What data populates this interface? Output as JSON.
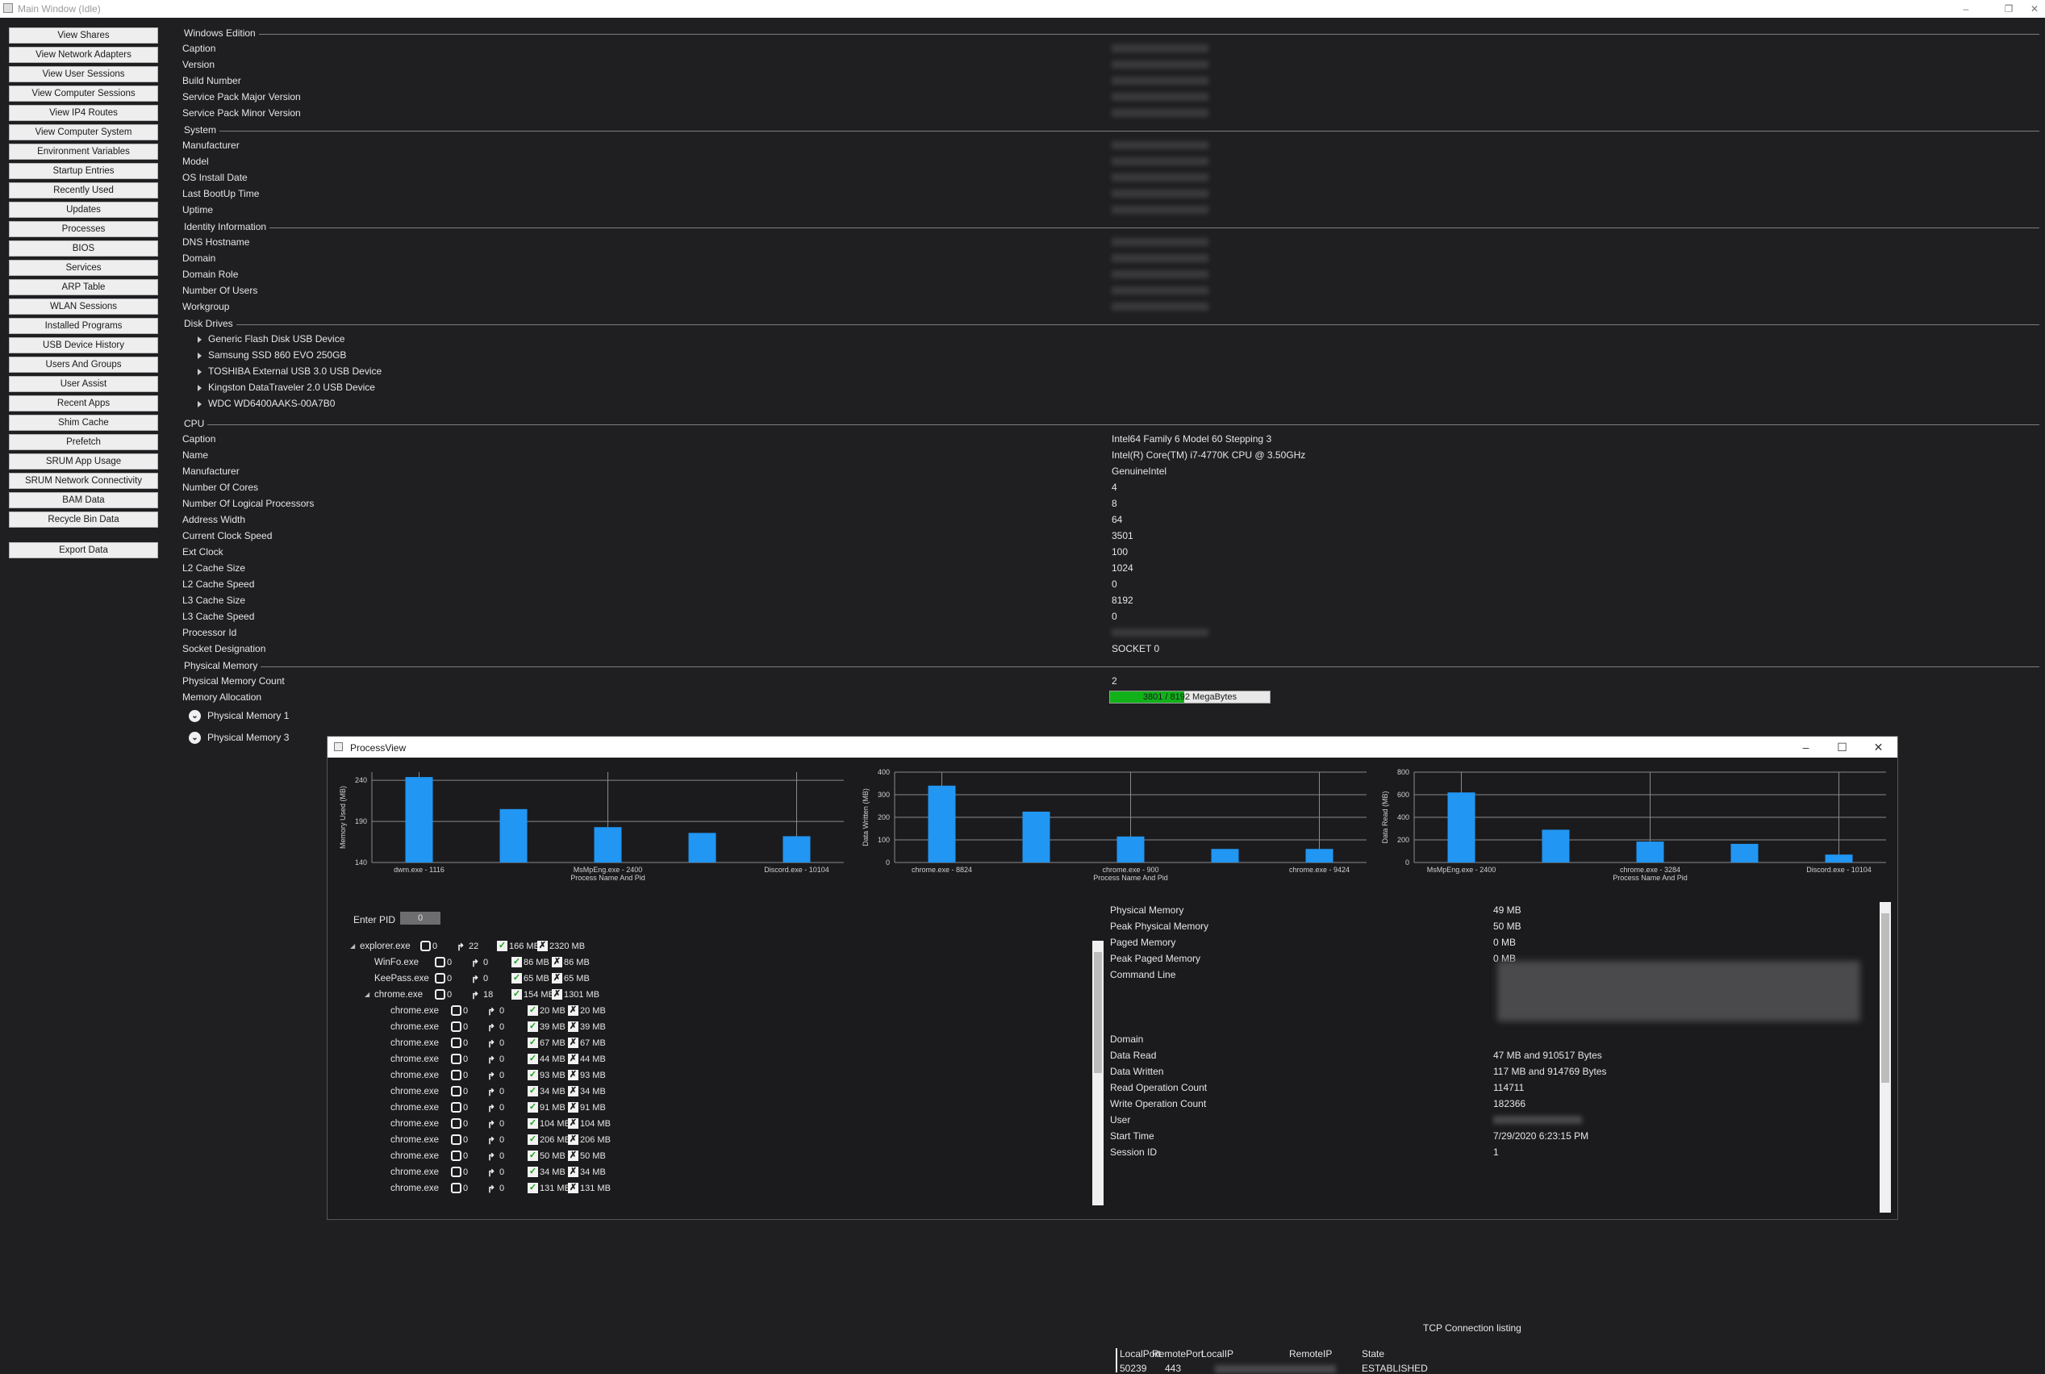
{
  "window": {
    "title": "Main Window (Idle)",
    "minimize": "–",
    "restore": "❐",
    "close": "✕"
  },
  "sidebar": {
    "buttons": [
      "View Shares",
      "View Network Adapters",
      "View User Sessions",
      "View Computer Sessions",
      "View IP4 Routes",
      "View Computer System",
      "Environment Variables",
      "Startup Entries",
      "Recently Used",
      "Updates",
      "Processes",
      "BIOS",
      "Services",
      "ARP Table",
      "WLAN Sessions",
      "Installed Programs",
      "USB Device History",
      "Users And Groups",
      "User Assist",
      "Recent Apps",
      "Shim Cache",
      "Prefetch",
      "SRUM App Usage",
      "SRUM Network Connectivity",
      "BAM Data",
      "Recycle Bin Data"
    ],
    "export": "Export Data"
  },
  "sections": {
    "windows_edition": {
      "title": "Windows Edition",
      "rows": [
        "Caption",
        "Version",
        "Build Number",
        "Service Pack Major Version",
        "Service Pack Minor Version"
      ]
    },
    "system": {
      "title": "System",
      "rows": [
        "Manufacturer",
        "Model",
        "OS Install Date",
        "Last BootUp Time",
        "Uptime"
      ]
    },
    "identity": {
      "title": "Identity Information",
      "rows": [
        "DNS Hostname",
        "Domain",
        "Domain Role",
        "Number Of Users",
        "Workgroup"
      ]
    },
    "disks": {
      "title": "Disk Drives",
      "items": [
        "Generic Flash Disk USB Device",
        "Samsung SSD 860 EVO 250GB",
        "TOSHIBA External USB 3.0 USB Device",
        "Kingston DataTraveler 2.0 USB Device",
        "WDC WD6400AAKS-00A7B0"
      ]
    },
    "cpu": {
      "title": "CPU",
      "rows": [
        {
          "k": "Caption",
          "v": "Intel64 Family 6 Model 60 Stepping 3"
        },
        {
          "k": "Name",
          "v": "Intel(R) Core(TM) i7-4770K CPU @ 3.50GHz"
        },
        {
          "k": "Manufacturer",
          "v": "GenuineIntel"
        },
        {
          "k": "Number Of Cores",
          "v": "4"
        },
        {
          "k": "Number Of Logical Processors",
          "v": "8"
        },
        {
          "k": "Address Width",
          "v": "64"
        },
        {
          "k": "Current Clock Speed",
          "v": "3501"
        },
        {
          "k": "Ext Clock",
          "v": "100"
        },
        {
          "k": "L2 Cache Size",
          "v": "1024"
        },
        {
          "k": "L2 Cache Speed",
          "v": "0"
        },
        {
          "k": "L3 Cache Size",
          "v": "8192"
        },
        {
          "k": "L3 Cache Speed",
          "v": "0"
        },
        {
          "k": "Processor Id",
          "v": ""
        },
        {
          "k": "Socket Designation",
          "v": "SOCKET 0"
        }
      ]
    },
    "physical_memory": {
      "title": "Physical Memory",
      "count_label": "Physical Memory Count",
      "count": "2",
      "alloc_label": "Memory Allocation",
      "alloc_text": "3801 / 8192 MegaBytes",
      "alloc_fraction": 0.464,
      "items": [
        "Physical Memory 1",
        "Physical Memory 3"
      ]
    }
  },
  "process_view": {
    "title": "ProcessView",
    "enter_pid_label": "Enter PID",
    "pid_value": "0",
    "tree": [
      {
        "name": "explorer.exe",
        "level": 0,
        "expanded": true,
        "handles": "0",
        "threads": "22",
        "mem": "166 MB",
        "peak": "2320 MB"
      },
      {
        "name": "WinFo.exe",
        "level": 1,
        "handles": "0",
        "threads": "0",
        "mem": "86 MB",
        "peak": "86 MB"
      },
      {
        "name": "KeePass.exe",
        "level": 1,
        "handles": "0",
        "threads": "0",
        "mem": "65 MB",
        "peak": "65 MB"
      },
      {
        "name": "chrome.exe",
        "level": 1,
        "expanded": true,
        "handles": "0",
        "threads": "18",
        "mem": "154 MB",
        "peak": "1301 MB"
      },
      {
        "name": "chrome.exe",
        "level": 2,
        "handles": "0",
        "threads": "0",
        "mem": "20 MB",
        "peak": "20 MB"
      },
      {
        "name": "chrome.exe",
        "level": 2,
        "handles": "0",
        "threads": "0",
        "mem": "39 MB",
        "peak": "39 MB"
      },
      {
        "name": "chrome.exe",
        "level": 2,
        "handles": "0",
        "threads": "0",
        "mem": "67 MB",
        "peak": "67 MB"
      },
      {
        "name": "chrome.exe",
        "level": 2,
        "handles": "0",
        "threads": "0",
        "mem": "44 MB",
        "peak": "44 MB"
      },
      {
        "name": "chrome.exe",
        "level": 2,
        "handles": "0",
        "threads": "0",
        "mem": "93 MB",
        "peak": "93 MB"
      },
      {
        "name": "chrome.exe",
        "level": 2,
        "handles": "0",
        "threads": "0",
        "mem": "34 MB",
        "peak": "34 MB"
      },
      {
        "name": "chrome.exe",
        "level": 2,
        "handles": "0",
        "threads": "0",
        "mem": "91 MB",
        "peak": "91 MB"
      },
      {
        "name": "chrome.exe",
        "level": 2,
        "handles": "0",
        "threads": "0",
        "mem": "104 MB",
        "peak": "104 MB"
      },
      {
        "name": "chrome.exe",
        "level": 2,
        "handles": "0",
        "threads": "0",
        "mem": "206 MB",
        "peak": "206 MB"
      },
      {
        "name": "chrome.exe",
        "level": 2,
        "handles": "0",
        "threads": "0",
        "mem": "50 MB",
        "peak": "50 MB"
      },
      {
        "name": "chrome.exe",
        "level": 2,
        "handles": "0",
        "threads": "0",
        "mem": "34 MB",
        "peak": "34 MB"
      },
      {
        "name": "chrome.exe",
        "level": 2,
        "handles": "0",
        "threads": "0",
        "mem": "131 MB",
        "peak": "131 MB"
      }
    ],
    "info": [
      {
        "k": "Physical Memory",
        "v": "49 MB"
      },
      {
        "k": "Peak Physical Memory",
        "v": "50 MB"
      },
      {
        "k": "Paged Memory",
        "v": "0 MB"
      },
      {
        "k": "Peak Paged Memory",
        "v": "0 MB"
      },
      {
        "k": "Command Line",
        "v": ""
      }
    ],
    "info2": [
      {
        "k": "Domain",
        "v": ""
      },
      {
        "k": "Data Read",
        "v": "47 MB and 910517 Bytes"
      },
      {
        "k": "Data Written",
        "v": "117 MB and 914769 Bytes"
      },
      {
        "k": "Read Operation Count",
        "v": "114711"
      },
      {
        "k": "Write Operation Count",
        "v": "182366"
      },
      {
        "k": "User",
        "v": ""
      },
      {
        "k": "Start Time",
        "v": "7/29/2020 6:23:15 PM"
      },
      {
        "k": "Session ID",
        "v": "1"
      }
    ],
    "tcp": {
      "title": "TCP Connection listing",
      "headers": [
        "LocalPort",
        "RemotePort",
        "LocalIP",
        "RemoteIP",
        "State"
      ],
      "row": {
        "local_port": "50239",
        "remote_port": "443",
        "state": "ESTABLISHED"
      }
    }
  },
  "chart_data": [
    {
      "type": "bar",
      "ylabel": "Memory Used (MB)",
      "xlabel": "Process Name And Pid",
      "ylim": [
        140,
        250
      ],
      "yticks": [
        140,
        190,
        240
      ],
      "categories": [
        "dwm.exe - 1116",
        "",
        "MsMpEng.exe - 2400",
        "",
        "Discord.exe - 10104"
      ],
      "values": [
        244,
        205,
        183,
        176,
        172
      ],
      "color": "#2196f3"
    },
    {
      "type": "bar",
      "ylabel": "Data Written (MB)",
      "xlabel": "Process Name And Pid",
      "ylim": [
        0,
        400
      ],
      "yticks": [
        0,
        100,
        200,
        300,
        400
      ],
      "categories": [
        "chrome.exe - 8824",
        "",
        "chrome.exe - 900",
        "",
        "chrome.exe - 9424"
      ],
      "values": [
        340,
        225,
        115,
        60,
        60
      ],
      "color": "#2196f3"
    },
    {
      "type": "bar",
      "ylabel": "Data Read (MB)",
      "xlabel": "Process Name And Pid",
      "ylim": [
        0,
        800
      ],
      "yticks": [
        0,
        200,
        400,
        600,
        800
      ],
      "categories": [
        "MsMpEng.exe - 2400",
        "",
        "chrome.exe - 3284",
        "",
        "Discord.exe - 10104"
      ],
      "values": [
        620,
        290,
        185,
        165,
        70
      ],
      "color": "#2196f3"
    }
  ]
}
